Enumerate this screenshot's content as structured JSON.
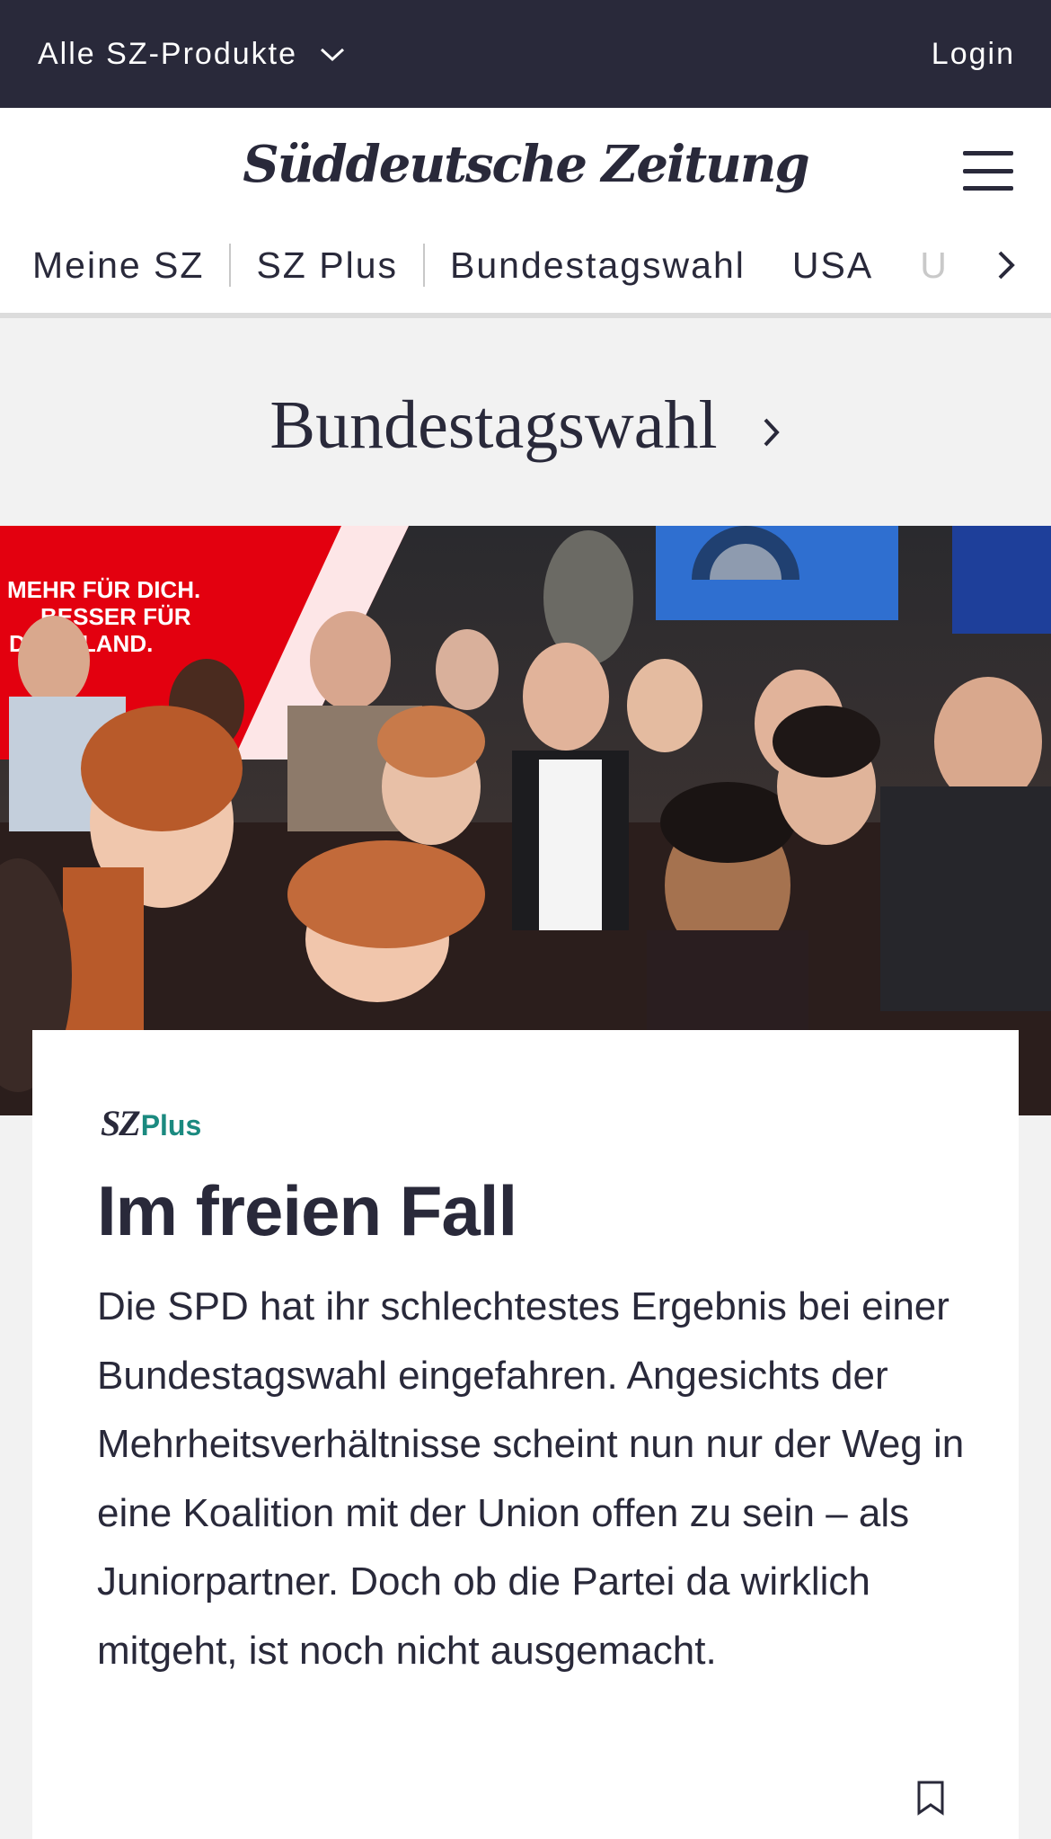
{
  "topbar": {
    "products_label": "Alle SZ-Produkte",
    "login_label": "Login"
  },
  "header": {
    "logo_text": "Süddeutsche Zeitung"
  },
  "nav": {
    "items": [
      "Meine SZ",
      "SZ Plus",
      "Bundestagswahl",
      "USA",
      "U"
    ]
  },
  "section": {
    "title": "Bundestagswahl"
  },
  "hero": {
    "banner_line1": "MEHR FÜR DICH.",
    "banner_line2": "BESSER FÜR",
    "banner_line3": "D  SCHLAND."
  },
  "article": {
    "brand_sz": "SZ",
    "brand_plus": "Plus",
    "headline": "Im freien Fall",
    "teaser": "Die SPD hat ihr schlechtestes Ergebnis bei einer Bundestagswahl eingefahren. Angesichts der Mehrheitsverhältnisse scheint nun nur der Weg in eine Koalition mit der Union offen zu sein – als Juniorpartner. Doch ob die Partei da wirklich mitgeht, ist noch nicht ausgemacht."
  },
  "colors": {
    "topbar_bg": "#29293a",
    "text": "#29293a",
    "plus_accent": "#1b8a80",
    "page_bg": "#f2f2f2",
    "spd_red": "#e3000f"
  }
}
